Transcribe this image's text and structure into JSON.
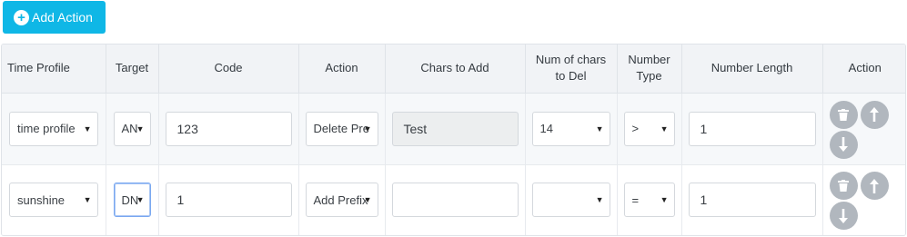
{
  "toolbar": {
    "add_label": "Add Action"
  },
  "table": {
    "headers": {
      "time_profile": "Time Profile",
      "target": "Target",
      "code": "Code",
      "action": "Action",
      "chars_to_add": "Chars to Add",
      "num_chars_del_1": "Num of chars",
      "num_chars_del_2": "to Del",
      "number_type_1": "Number",
      "number_type_2": "Type",
      "number_length": "Number Length",
      "actions": "Action"
    },
    "rows": [
      {
        "time_profile": "time profile",
        "target": "AN",
        "code": "123",
        "action": "Delete Pre",
        "chars_to_add": "Test",
        "num_chars_del": "14",
        "number_type": ">",
        "number_length": "1"
      },
      {
        "time_profile": "sunshine",
        "target": "DN",
        "code": "1",
        "action": "Add Prefix",
        "chars_to_add": "",
        "num_chars_del": "",
        "number_type": "=",
        "number_length": "1"
      }
    ]
  },
  "icons": {
    "caret": "▼",
    "add": "plus-circle-icon",
    "delete": "trash-icon",
    "up": "arrow-up-icon",
    "down": "arrow-down-icon"
  },
  "colors": {
    "primary": "#0fb7e6",
    "icon_button": "#b1b7be",
    "focus_border": "#7aa8f0"
  }
}
